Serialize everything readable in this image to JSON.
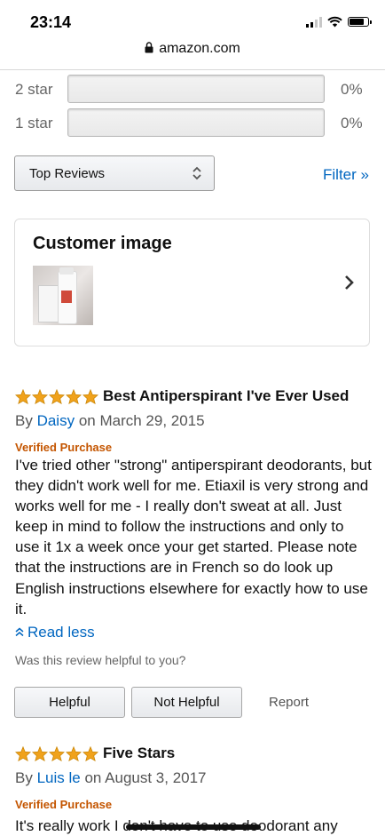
{
  "status_bar": {
    "time": "23:14"
  },
  "browser": {
    "url": "amazon.com"
  },
  "rating_bars": [
    {
      "label": "2 star",
      "percent": "0%",
      "fill": 0
    },
    {
      "label": "1 star",
      "percent": "0%",
      "fill": 0
    }
  ],
  "sort": {
    "selected": "Top Reviews"
  },
  "filter": {
    "label": "Filter »"
  },
  "customer_image": {
    "heading": "Customer image"
  },
  "reviews": [
    {
      "stars": 5,
      "title": "Best Antiperspirant I've Ever Used",
      "by": "By",
      "author": "Daisy",
      "date": "on March 29, 2015",
      "verified": "Verified Purchase",
      "body": "I've tried other \"strong\" antiperspirant deodorants, but they didn't work well for me. Etiaxil is very strong and works well for me - I really don't sweat at all. Just keep in mind to follow the instructions and only to use it 1x a week once your get started. Please note that the instructions are in French so do look up English instructions elsewhere for exactly how to use it.",
      "read_less": "Read less",
      "helpful_question": "Was this review helpful to you?",
      "helpful_button": "Helpful",
      "not_helpful_button": "Not Helpful",
      "report": "Report"
    },
    {
      "stars": 5,
      "title": "Five Stars",
      "by": "By",
      "author": "Luis le",
      "date": "on August 3, 2017",
      "verified": "Verified Purchase",
      "body": "It's really work I don't have to use deodorant any"
    }
  ],
  "colors": {
    "link": "#0066c0",
    "verified": "#c45500",
    "star": "#f0a21c"
  }
}
